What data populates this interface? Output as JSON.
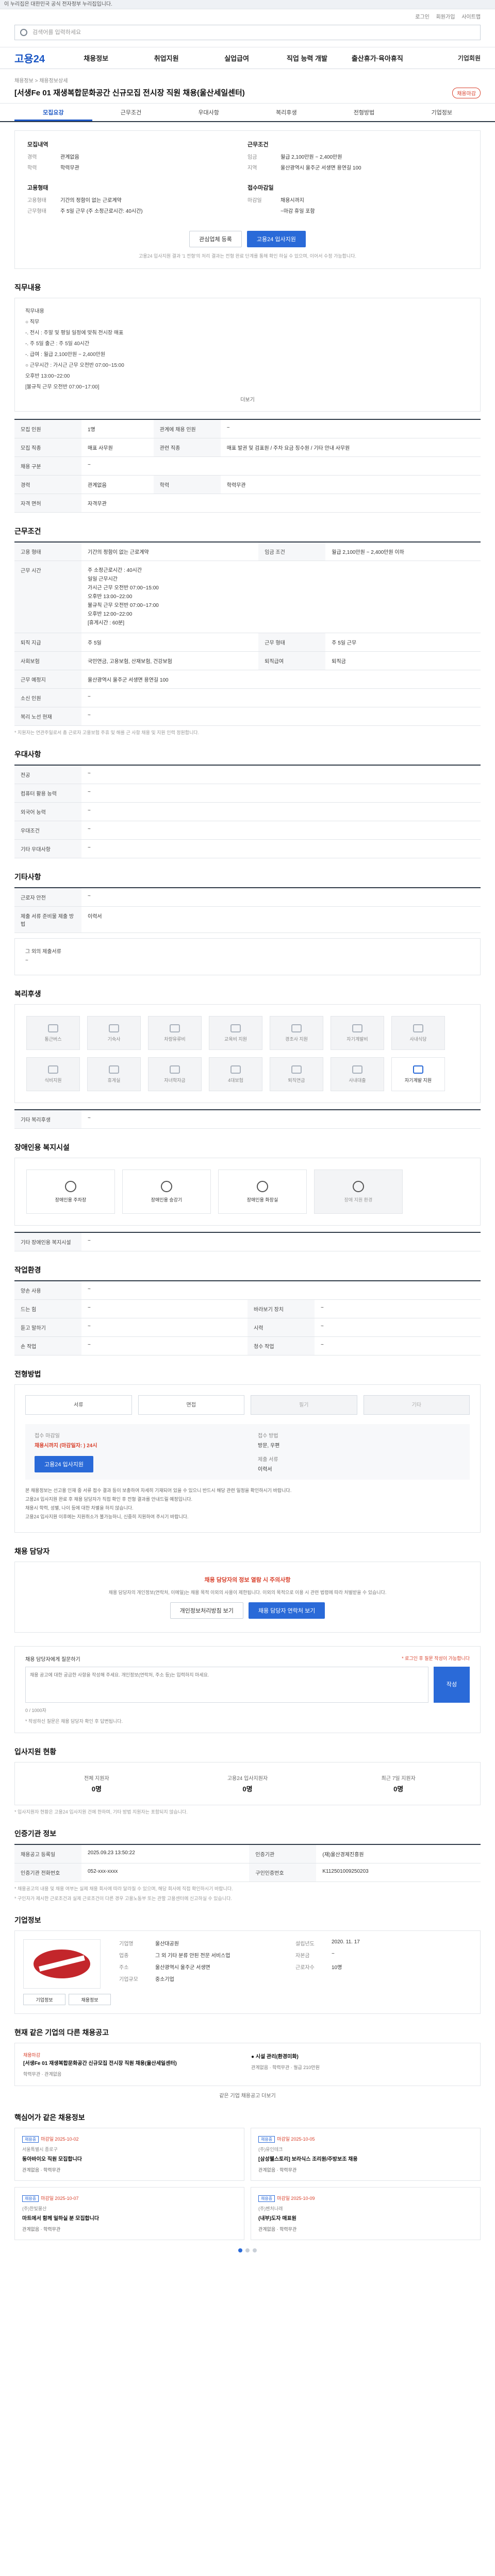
{
  "gov_bar": "이 누리집은 대한민국 공식 전자정부 누리집입니다.",
  "utility": [
    "로그인",
    "회원가입",
    "사이트맵"
  ],
  "search": {
    "placeholder": "검색어를 입력하세요",
    "button": "검색"
  },
  "logo": "고용24",
  "gnb": [
    "채용정보",
    "취업지원",
    "실업급여",
    "직업 능력 개발",
    "출산휴가·육아휴직"
  ],
  "gnb_end": "기업회원",
  "breadcrumb": "채용정보 > 채용정보상세",
  "job_title": "[서생Fe 01 재생복합문화공간 신규모집 전시장 직원 채용(울산세일센터)",
  "status_badge": "채용마감",
  "tabs": [
    "모집요강",
    "근무조건",
    "우대사항",
    "복리후생",
    "전형방법",
    "기업정보"
  ],
  "summary": {
    "recruit_heading": "모집내역",
    "recruit": [
      {
        "k": "경력",
        "v": "관계없음"
      },
      {
        "k": "학력",
        "v": "학력무관"
      }
    ],
    "cond_heading": "근무조건",
    "cond": [
      {
        "k": "임금",
        "v": "월급 2,100만원 ~ 2,400만원"
      },
      {
        "k": "지역",
        "v": "울산광역시 울주군 서생면 용연길 100"
      }
    ],
    "type_heading": "고용형태",
    "type": [
      {
        "k": "고용형태",
        "v": "기간의 정함이 없는 근로계약"
      },
      {
        "k": "근무형태",
        "v": "주 5일 근무 (주 소정근로시간: 40시간)"
      }
    ],
    "deadline_heading": "접수마감일",
    "deadline": [
      {
        "k": "마감일",
        "v": "채용시까지"
      },
      {
        "k": "",
        "v": "~마감 휴일 포함"
      }
    ],
    "btn_interest": "관심업체 등록",
    "btn_apply": "고용24 입사지원",
    "notice": "고용24 입사지원 결과 '1 전형'의 처리 결과는 전형 완료 단계를 통해 확인 하실 수 있으며, 이어서 수정 가능합니다."
  },
  "duty": {
    "heading": "직무내용",
    "label": "직무내용",
    "lines": [
      "○ 직무",
      "  -. 전시 : 주말 및 평일 일정에 맞춰 전시장 매표",
      "  -. 주 5일 출근 : 주 5일 40시간",
      "  -. 급여 : 월급 2,100만원 ~ 2,400만원",
      "○ 근무시간 : 가시근 근무 오전반 07:00~15:00",
      "               오후반 13:00~22:00",
      "               [불규칙 근무 오전반 07:00~17:00]"
    ],
    "more": "더보기"
  },
  "recruit_table": [
    {
      "k": "모집 인원",
      "v": "1명",
      "k2": "관계에 채용 인원",
      "v2": "~"
    },
    {
      "k": "모집 직종",
      "v": "매표 사무원",
      "k2": "관련 직종",
      "v2": "매표 발권 및 검표원 / 주차 요금 징수원 / 기타 안내 사무원"
    },
    {
      "k": "채용 구분",
      "v": "~",
      "k2": "",
      "v2": ""
    },
    {
      "k": "경력",
      "v": "관계없음",
      "k2": "학력",
      "v2": "학력무관"
    },
    {
      "k": "자격 면허",
      "v": "자격무관",
      "k2": "",
      "v2": ""
    }
  ],
  "work": {
    "heading": "근무조건",
    "rows": [
      {
        "k": "고용 형태",
        "v": "기간의 정함이 없는 근로계약",
        "k2": "임금 조건",
        "v2": "월급 2,100만원 ~ 2,400만원 이하"
      },
      {
        "k": "근무 시간",
        "v": "주 소정근로시간 : 40시간\n일일 근무시간\n  가시근 근무 오전반 07:00~15:00\n           오후반 13:00~22:00\n  불규칙 근무 오전반 07:00~17:00\n           오후반 12:00~22:00\n  [휴게시간 : 60분]",
        "k2": "",
        "v2": ""
      },
      {
        "k": "퇴직 지급",
        "v": "주 5일",
        "k2": "근무 형태",
        "v2": "주 5일 근무"
      },
      {
        "k": "사회보험",
        "v": "국민연금, 고용보험, 산재보험, 건강보험",
        "k2": "퇴직급여",
        "v2": "퇴직금"
      },
      {
        "k": "근무 예정지",
        "v": "울산광역시 울주군 서생면 용연길 100",
        "k2": "",
        "v2": ""
      },
      {
        "k": "소신 인원",
        "v": "~",
        "k2": "",
        "v2": ""
      },
      {
        "k": "복리 노선 현재",
        "v": "~",
        "k2": "",
        "v2": ""
      }
    ],
    "note": "* 지원자는 연관주일로서 총 근로자 고용보험 주휴 및 해를 근 사항 채용 및 지원 인력 정원합니다."
  },
  "pref": {
    "heading": "우대사항",
    "rows": [
      {
        "k": "전공",
        "v": "~"
      },
      {
        "k": "컴퓨터 활용 능력",
        "v": "~"
      },
      {
        "k": "외국어 능력",
        "v": "~"
      },
      {
        "k": "우대조건",
        "v": "~"
      },
      {
        "k": "기타 우대사항",
        "v": "~"
      }
    ]
  },
  "etc": {
    "heading": "기타사항",
    "rows": [
      {
        "k": "근로자 안전",
        "v": "~"
      },
      {
        "k": "제출 서류 준비물 제출 방법",
        "v": "이력서"
      }
    ],
    "extra_label": "그 외의 제출서류",
    "extra_value": "~"
  },
  "welfare": {
    "heading": "복리후생",
    "items": [
      "통근버스",
      "기숙사",
      "차량유류비",
      "교육비 지원",
      "경조사 지원",
      "자기계발비",
      "사내식당",
      "식비지원",
      "휴게실",
      "자녀학자금",
      "4대보험",
      "퇴직연금",
      "사내대출",
      "자기계발 지원"
    ],
    "on_index": 13,
    "other_label": "기타 복리후생",
    "other_value": "~"
  },
  "disability": {
    "heading": "장애인용 복지시설",
    "items": [
      "장애인용 주차장",
      "장애인용 승강기",
      "장애인용 화장실",
      "장애 지원 환경"
    ],
    "other_label": "기타 장애인용 복지시설",
    "other_value": "~"
  },
  "office": {
    "heading": "작업환경",
    "rows": [
      {
        "k": "양손 사용",
        "v": "~",
        "k2": "",
        "v2": ""
      },
      {
        "k": "드는 힘",
        "v": "~",
        "k2": "바라보기 장치",
        "v2": "~"
      },
      {
        "k": "듣고 말하기",
        "v": "~",
        "k2": "시력",
        "v2": "~"
      },
      {
        "k": "손 작업",
        "v": "~",
        "k2": "청수 작업",
        "v2": "~"
      }
    ]
  },
  "selection": {
    "heading": "전형방법",
    "methods": [
      "서류",
      "면접",
      "필기",
      "기타"
    ],
    "deadline_label": "접수 마감일",
    "deadline": "채용시까지 (마감일자: ) 24시",
    "method_label": "접수 방법",
    "method_value": "방문, 우편",
    "form_label": "제출 서류",
    "form_value": "이력서",
    "apply_btn": "고용24 입사지원",
    "bullets": [
      "본 채용정보는 선고용 인재 중 서류 접수 결과 등이 보충하여 자세히 기재되어 있을 수 있으니 반드시 해당 관련 일정을 확인하시기 바랍니다.",
      "고용24 입사지원 완료 후 채용 담당자가 직접 확인 후 전형 결과를 안내드릴 예정입니다.",
      "채용시 학력, 성별, 나이 등에 대한 차별을 하지 않습니다.",
      "고용24 입사지원 이후에는 지원취소가 불가능하니, 신중히 지원하여 주시기 바랍니다."
    ]
  },
  "contact": {
    "heading": "채용 담당자",
    "warn": "채용 담당자의 정보 열람 시 주의사항",
    "desc": "채용 담당자의 개인정보(연락처, 이메일)는 채용 목적 이외의 사용이 제한됩니다. 이외의 목적으로 이용 시 관련 법령에 따라 처벌받을 수 있습니다.",
    "btn_view": "개인정보처리방침 보기",
    "btn_check": "채용 담당자 연락처 보기"
  },
  "qa": {
    "label": "채용 담당자에게 질문하기",
    "hint": "* 로그인 후 질문 작성이 가능합니다",
    "placeholder": "채용 공고에 대한 궁금한 사항을 작성해 주세요. 개인정보(연락처, 주소 등)는 입력하지 마세요.",
    "submit": "작성",
    "counter": "0 / 1000자",
    "foot": "* 작성하신 질문은 채용 담당자 확인 후 답변됩니다."
  },
  "stats": {
    "heading": "입사지원 현황",
    "more": "더보기",
    "items": [
      {
        "label": "전체 지원자",
        "n": "0명"
      },
      {
        "label": "고용24 입사지원자",
        "n": "0명"
      },
      {
        "label": "최근 7일 지원자",
        "n": "0명"
      }
    ],
    "note": "* 입사지원자 현황은 고용24 입사지원 건에 한하며, 기타 방법 지원자는 포함되지 않습니다."
  },
  "req_info": {
    "heading": "인증기관 정보",
    "more": "인증 정보 더보기",
    "rows": [
      {
        "k": "채용공고 등록일",
        "v": "2025.09.23 13:50:22",
        "k2": "인증기관",
        "v2": "(재)울산경제진흥원"
      },
      {
        "k": "인증기관 전화번호",
        "v": "052-xxx-xxxx",
        "k2": "구인인증번호",
        "v2": "K112501009250203"
      }
    ],
    "notes": [
      "* 채용공고의 내용 및 채용 여부는 실제 채용 회사에 따라 달라질 수 있으며, 해당 회사에 직접 확인하시기 바랍니다.",
      "* 구인자가 제시한 근로조건과 실제 근로조건이 다른 경우 고용노동부 또는 관할 고용센터에 신고하실 수 있습니다."
    ]
  },
  "company": {
    "heading": "기업정보",
    "btn1": "기업정보",
    "btn2": "채용정보",
    "rows": [
      {
        "k": "기업명",
        "v": "울산대공원",
        "k2": "설립년도",
        "v2": "2020. 11. 17"
      },
      {
        "k": "업종",
        "v": "그 외 기타 분류 안된 전문 서비스업",
        "k2": "자본금",
        "v2": "~"
      },
      {
        "k": "주소",
        "v": "울산광역시 울주군 서생면",
        "k2": "근로자수",
        "v2": "10명"
      },
      {
        "k": "기업규모",
        "v": "중소기업",
        "k2": "",
        "v2": ""
      }
    ]
  },
  "others": {
    "heading": "현재 같은 기업의 다른 채용공고",
    "more": "같은 기업 채용공고 더보기",
    "items": [
      {
        "tag": "채용마감",
        "title": "[서생Fe 01 재생복합문화공간 신규모집 전시장 직원 채용(울산세일센터)",
        "meta": "학력무관 · 관계없음"
      },
      {
        "tag": "",
        "title": "● 시설 관리(환경미화)",
        "meta": "관계없음 · 학력무관 · 월급 210만원"
      }
    ]
  },
  "similar": {
    "heading": "핵심어가 같은 채용정보",
    "more": "더보기",
    "cards": [
      {
        "chip": "채용중",
        "tag": "마감일 2025-10-02",
        "co": "서울특별시 종로구",
        "title": "동아바이오 직원 모집합니다",
        "meta": "관계없음 · 학력무관"
      },
      {
        "chip": "채용중",
        "tag": "마감일 2025-10-05",
        "co": "(주)유인테크",
        "title": "[삼성웰스토리] 보라식스 조리원/주방보조 채용",
        "meta": "관계없음 · 학력무관"
      },
      {
        "chip": "채용중",
        "tag": "마감일 2025-10-07",
        "co": "(주)한빛물산",
        "title": "마트에서 함께 일하실 분 모집합니다",
        "meta": "관계없음 · 학력무관"
      },
      {
        "chip": "채용중",
        "tag": "마감일 2025-10-09",
        "co": "(주)벤처나래",
        "title": "(내부)도자 매표원",
        "meta": "관계없음 · 학력무관"
      }
    ]
  }
}
